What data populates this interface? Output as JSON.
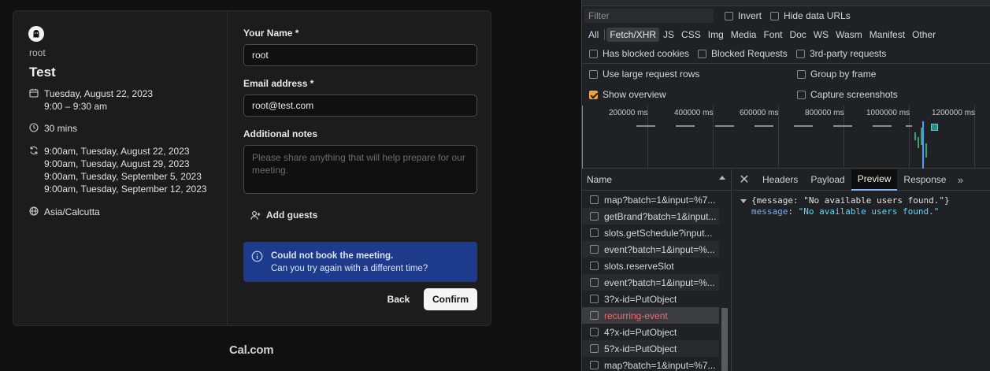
{
  "booking": {
    "host": "root",
    "event_title": "Test",
    "date_line1": "Tuesday, August 22, 2023",
    "date_line2": "9:00 – 9:30 am",
    "duration": "30 mins",
    "recurring": [
      "9:00am, Tuesday, August 22, 2023",
      "9:00am, Tuesday, August 29, 2023",
      "9:00am, Tuesday, September 5, 2023",
      "9:00am, Tuesday, September 12, 2023"
    ],
    "timezone": "Asia/Calcutta",
    "form": {
      "name_label": "Your Name *",
      "name_value": "root",
      "email_label": "Email address *",
      "email_value": "root@test.com",
      "notes_label": "Additional notes",
      "notes_placeholder": "Please share anything that will help prepare for our meeting.",
      "add_guests": "Add guests"
    },
    "alert": {
      "title": "Could not book the meeting.",
      "message": "Can you try again with a different time?",
      "color": "#1e3a8a"
    },
    "back_label": "Back",
    "confirm_label": "Confirm",
    "brand": "Cal.com"
  },
  "devtools": {
    "filter_placeholder": "Filter",
    "invert_label": "Invert",
    "hide_data_urls_label": "Hide data URLs",
    "type_filters": [
      "All",
      "Fetch/XHR",
      "JS",
      "CSS",
      "Img",
      "Media",
      "Font",
      "Doc",
      "WS",
      "Wasm",
      "Manifest",
      "Other"
    ],
    "active_type_filter": "Fetch/XHR",
    "blocked_cookies_label": "Has blocked cookies",
    "blocked_requests_label": "Blocked Requests",
    "third_party_label": "3rd-party requests",
    "large_rows_label": "Use large request rows",
    "group_by_frame_label": "Group by frame",
    "show_overview_label": "Show overview",
    "capture_screenshots_label": "Capture screenshots",
    "overview_labels": [
      "200000 ms",
      "400000 ms",
      "600000 ms",
      "800000 ms",
      "1000000 ms",
      "1200000 ms"
    ],
    "name_header": "Name",
    "requests": [
      {
        "name": "map?batch=1&input=%7...",
        "error": false
      },
      {
        "name": "getBrand?batch=1&input...",
        "error": false
      },
      {
        "name": "slots.getSchedule?input...",
        "error": false
      },
      {
        "name": "event?batch=1&input=%...",
        "error": false
      },
      {
        "name": "slots.reserveSlot",
        "error": false
      },
      {
        "name": "event?batch=1&input=%...",
        "error": false
      },
      {
        "name": "3?x-id=PutObject",
        "error": false
      },
      {
        "name": "recurring-event",
        "error": true
      },
      {
        "name": "4?x-id=PutObject",
        "error": false
      },
      {
        "name": "5?x-id=PutObject",
        "error": false
      },
      {
        "name": "map?batch=1&input=%7...",
        "error": false
      }
    ],
    "detail_tabs": [
      "Headers",
      "Payload",
      "Preview",
      "Response"
    ],
    "active_detail_tab": "Preview",
    "preview_summary": "{message: \"No available users found.\"}",
    "preview_key": "message",
    "preview_value": "\"No available users found.\""
  }
}
